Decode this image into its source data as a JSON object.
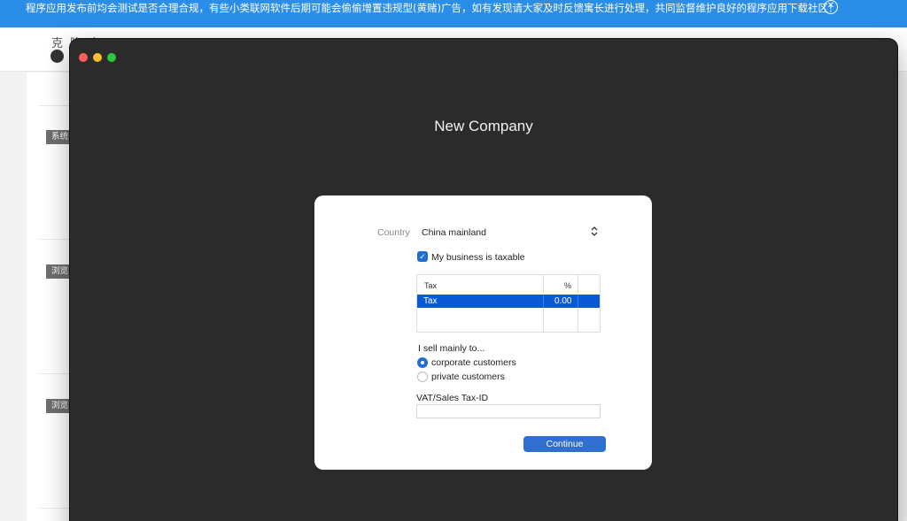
{
  "banner": {
    "text": "程序应用发布前均会测试是否合理合规，有些小类联网软件后期可能会偷偷增置违规型(黄赌)广告，如有发现请大家及时反馈寓长进行处理，共同监督维护良好的程序应用下载社区！",
    "close_glyph": "✕"
  },
  "site": {
    "logo_text": "克隆窝",
    "tags": [
      "系统",
      "浏览",
      "浏览"
    ]
  },
  "window": {
    "title": "New Company"
  },
  "form": {
    "country_label": "Country",
    "country_value": "China mainland",
    "chevron_glyph": "⌃⌄",
    "taxable_label": "My business is taxable",
    "taxable_checked": true,
    "check_glyph": "✓",
    "tax_table": {
      "headers": [
        "Tax",
        "%"
      ],
      "rows": [
        {
          "name": "Tax",
          "value": "0.00"
        }
      ]
    },
    "sell_label": "I sell mainly to...",
    "sell_options": [
      {
        "label": "corporate customers",
        "checked": true
      },
      {
        "label": "private customers",
        "checked": false
      }
    ],
    "vat_label": "VAT/Sales Tax-ID",
    "vat_value": "",
    "continue_label": "Continue"
  },
  "colors": {
    "banner": "#2a8ee8",
    "window_bg": "#2b2b2b",
    "accent": "#1f6ed4",
    "selection": "#0a5ad6"
  },
  "icons": [
    "close-icon",
    "chevron-updown-icon",
    "checkmark-icon"
  ]
}
